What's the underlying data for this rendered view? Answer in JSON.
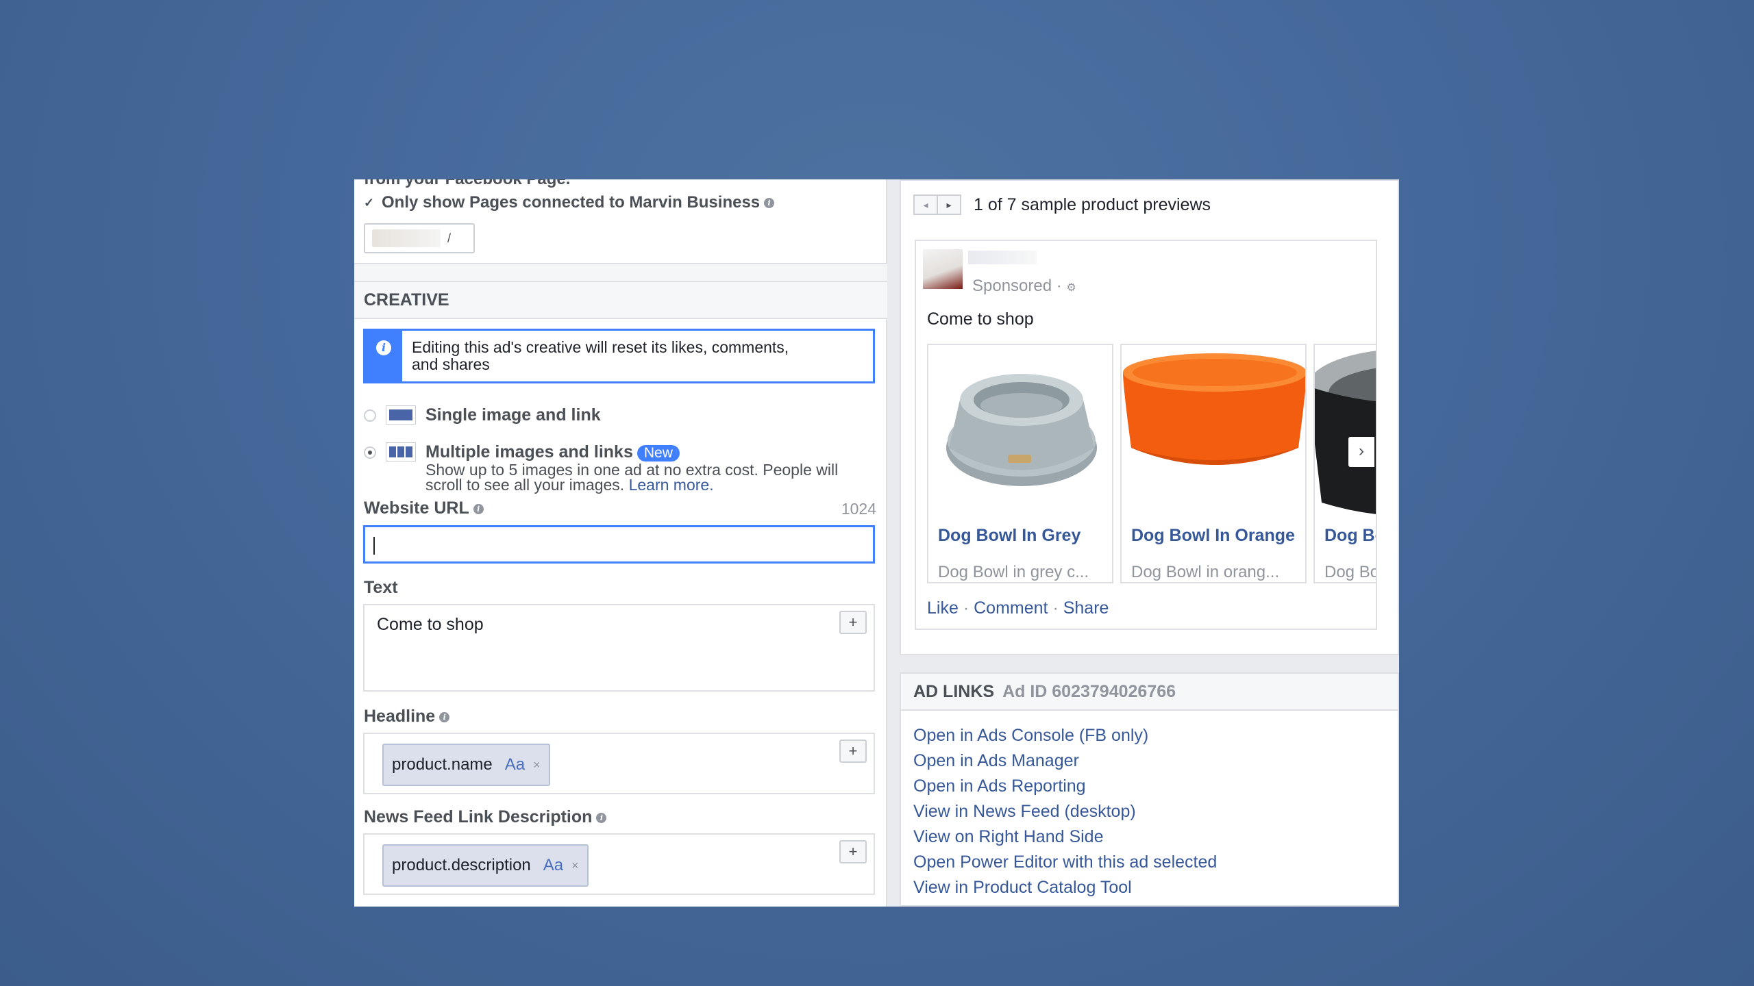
{
  "top": {
    "cut_text": "from your Facebook Page.",
    "checkbox_label": "Only show Pages connected to Marvin Business",
    "page_select_text": "/"
  },
  "creative": {
    "header": "CREATIVE",
    "notice": "Editing this ad's creative will reset its likes, comments, and shares",
    "options": {
      "single": "Single image and link",
      "multiple": "Multiple images and links",
      "new_badge": "New",
      "multiple_desc": "Show up to 5 images in one ad at no extra cost. People will scroll to see all your images.",
      "learn_more": "Learn more."
    },
    "website_url": {
      "label": "Website URL",
      "counter": "1024",
      "value": ""
    },
    "text": {
      "label": "Text",
      "value": "Come to shop"
    },
    "headline": {
      "label": "Headline",
      "token": "product.name",
      "token_aa": "Aa"
    },
    "link_description": {
      "label": "News Feed Link Description",
      "token": "product.description",
      "token_aa": "Aa"
    },
    "plus": "+"
  },
  "preview": {
    "pager_text": "1 of 7 sample product previews",
    "sponsored": "Sponsored ·",
    "body": "Come to shop",
    "items": [
      {
        "title": "Dog Bowl In Grey",
        "desc": "Dog Bowl in grey c..."
      },
      {
        "title": "Dog Bowl In Orange",
        "desc": "Dog Bowl in orang..."
      },
      {
        "title": "Dog Bo",
        "desc": "Dog Bo"
      }
    ],
    "actions": {
      "like": "Like",
      "comment": "Comment",
      "share": "Share"
    }
  },
  "ad_links": {
    "header": "AD LINKS",
    "ad_id": "Ad ID 6023794026766",
    "links": [
      "Open in Ads Console (FB only)",
      "Open in Ads Manager",
      "Open in Ads Reporting",
      "View in News Feed (desktop)",
      "View on Right Hand Side",
      "Open Power Editor with this ad selected",
      "View in Product Catalog Tool"
    ]
  },
  "colors": {
    "accent": "#4080ff",
    "link": "#365899",
    "background": "#45689a"
  }
}
